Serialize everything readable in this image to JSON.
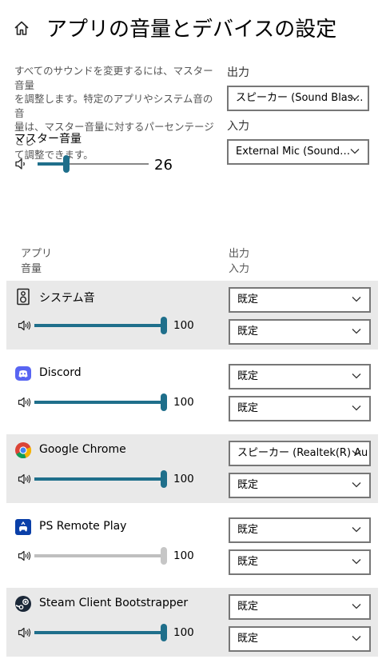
{
  "header": {
    "title": "アプリの音量とデバイスの設定"
  },
  "intro": {
    "lines": [
      "すべてのサウンドを変更するには、マスター音量",
      "を調整します。特定のアプリやシステム音の音",
      "量は、マスター音量に対するパーセンテージとし",
      "て調整できます。"
    ],
    "master_label": "マスター音量",
    "master_value": "26",
    "master_level": 0.26
  },
  "output": {
    "label": "出力",
    "value": "スピーカー (Sound Blas…"
  },
  "input": {
    "label": "入力",
    "value": "External Mic (Sound…"
  },
  "columns": {
    "app": "アプリ",
    "volume": "音量",
    "out": "出力",
    "in": "入力"
  },
  "apps": [
    {
      "name": "システム音",
      "icon": "speaker-box-icon",
      "volume": "100",
      "level": 1.0,
      "enabled": true,
      "out": "既定",
      "in": "既定",
      "shaded": true
    },
    {
      "name": "Discord",
      "icon": "discord-icon",
      "volume": "100",
      "level": 1.0,
      "enabled": true,
      "out": "既定",
      "in": "既定",
      "shaded": false
    },
    {
      "name": "Google Chrome",
      "icon": "chrome-icon",
      "volume": "100",
      "level": 1.0,
      "enabled": true,
      "out": "スピーカー (Realtek(R) Au",
      "in": "既定",
      "shaded": true
    },
    {
      "name": "PS Remote Play",
      "icon": "ps-remote-play-icon",
      "volume": "100",
      "level": 1.0,
      "enabled": false,
      "out": "既定",
      "in": "既定",
      "shaded": false
    },
    {
      "name": "Steam Client Bootstrapper",
      "icon": "steam-icon",
      "volume": "100",
      "level": 1.0,
      "enabled": true,
      "out": "既定",
      "in": "既定",
      "shaded": true
    }
  ]
}
